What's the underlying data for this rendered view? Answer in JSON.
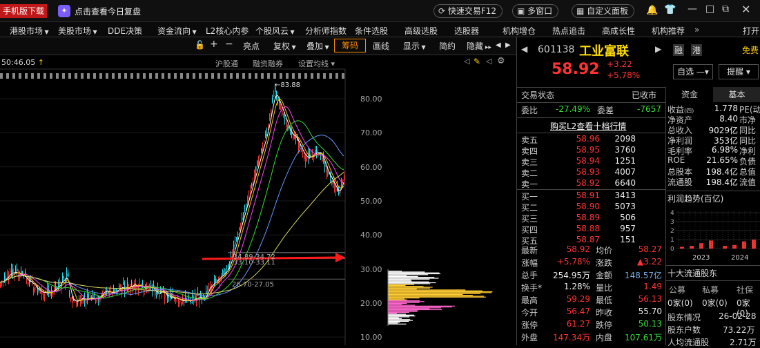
{
  "topbar": {
    "mobile_download": "手机版下载",
    "review_link": "点击查看今日复盘",
    "quick_trade": "快速交易F12",
    "multi_window": "多窗口",
    "custom_panel": "自定义面板"
  },
  "menu": [
    "港股市场",
    "美股市场",
    "DDE决策",
    "资金流向",
    "L2核心内参",
    "个股风云",
    "分析师指数",
    "条件选股",
    "高级选股",
    "选股器",
    "机构增仓",
    "热点追击",
    "高成长性",
    "机构推荐",
    "打开"
  ],
  "toolbar": {
    "items": [
      "亮点",
      "复权",
      "叠加",
      "筹码",
      "画线",
      "显示",
      "简约",
      "隐藏"
    ],
    "active": "筹码"
  },
  "chart": {
    "time_label": "50:46.05",
    "links": [
      "沪股通",
      "融资融券",
      "设置均线"
    ],
    "high_marker": "83.88",
    "yticks": [
      "80.00",
      "70.00",
      "60.00",
      "50.00",
      "40.00",
      "30.00",
      "20.00",
      "10.00"
    ],
    "chip_labels": [
      "34.89-34.72",
      "33.10-33.11",
      "26.70-27.05"
    ]
  },
  "quote": {
    "code": "601138",
    "name": "工业富联",
    "tag1": "融",
    "tag2": "港",
    "free_label": "免费",
    "price": "58.92",
    "change": "+3.22",
    "change_pct": "+5.78%",
    "watch_btn": "自选",
    "remind_btn": "提醒",
    "status_label": "交易状态",
    "status_value": "已收市",
    "webi_label": "委比",
    "webi_value": "-27.49%",
    "wecha_label": "委差",
    "wecha_value": "-7657",
    "l2_link": "购买L2查看十档行情"
  },
  "asks": [
    {
      "label": "卖五",
      "price": "58.96",
      "vol": "2098"
    },
    {
      "label": "卖四",
      "price": "58.95",
      "vol": "3760"
    },
    {
      "label": "卖三",
      "price": "58.94",
      "vol": "1251"
    },
    {
      "label": "卖二",
      "price": "58.93",
      "vol": "4007"
    },
    {
      "label": "卖一",
      "price": "58.92",
      "vol": "6640"
    }
  ],
  "bids": [
    {
      "label": "买一",
      "price": "58.91",
      "vol": "3413"
    },
    {
      "label": "买二",
      "price": "58.90",
      "vol": "5073"
    },
    {
      "label": "买三",
      "price": "58.89",
      "vol": "506"
    },
    {
      "label": "买四",
      "price": "58.88",
      "vol": "957"
    },
    {
      "label": "买五",
      "price": "58.87",
      "vol": "151"
    }
  ],
  "stats": [
    {
      "l1": "最新",
      "v1": "58.92",
      "c1": "red",
      "l2": "均价",
      "v2": "58.27",
      "c2": "red"
    },
    {
      "l1": "涨幅",
      "v1": "+5.78%",
      "c1": "red",
      "l2": "涨跌",
      "v2": "▲3.22",
      "c2": "red"
    },
    {
      "l1": "总手",
      "v1": "254.95万",
      "c1": "white",
      "l2": "金额",
      "v2": "148.57亿",
      "c2": "cy"
    },
    {
      "l1": "换手*",
      "v1": "1.28%",
      "c1": "white",
      "l2": "量比",
      "v2": "1.49",
      "c2": "red"
    },
    {
      "l1": "最高",
      "v1": "59.29",
      "c1": "red",
      "l2": "最低",
      "v2": "56.13",
      "c2": "red"
    },
    {
      "l1": "今开",
      "v1": "56.47",
      "c1": "red",
      "l2": "昨收",
      "v2": "55.70",
      "c2": "white"
    },
    {
      "l1": "涨停",
      "v1": "61.27",
      "c1": "red",
      "l2": "跌停",
      "v2": "50.13",
      "c2": "green"
    },
    {
      "l1": "外盘",
      "v1": "147.34万",
      "c1": "red",
      "l2": "内盘",
      "v2": "107.61万",
      "c2": "green"
    }
  ],
  "fund": {
    "tab_funds": "资金",
    "tab_basic": "基本",
    "rows": [
      {
        "label": "收益",
        "sup": "(四)",
        "value": "1.778",
        "extra": "PE(动"
      },
      {
        "label": "净资产",
        "sup": "",
        "value": "8.40",
        "extra": "市净"
      },
      {
        "label": "总收入",
        "sup": "",
        "value": "9029亿",
        "extra": "同比"
      },
      {
        "label": "净利润",
        "sup": "",
        "value": "353亿",
        "extra": "同比"
      },
      {
        "label": "毛利率",
        "sup": "",
        "value": "6.98%",
        "extra": "净利"
      },
      {
        "label": "ROE",
        "sup": "",
        "value": "21.65%",
        "extra": "负债"
      },
      {
        "label": "总股本",
        "sup": "",
        "value": "198.4亿",
        "extra": "总值"
      },
      {
        "label": "流通股",
        "sup": "",
        "value": "198.4亿",
        "extra": "流值"
      }
    ],
    "profit_title": "利润趋势(百亿)",
    "profit_yticks": [
      "4",
      "3",
      "2",
      "1",
      "0"
    ],
    "profit_years": [
      "2023",
      "2024"
    ],
    "holders_title": "十大流通股东",
    "holder_types": [
      "公募",
      "私募",
      "社保"
    ],
    "holder_counts": [
      "0家(0)",
      "0家(0)",
      "0家(0)"
    ],
    "holder_rows": [
      {
        "label": "股东情况",
        "value": "26-02-28"
      },
      {
        "label": "股东户数",
        "value": "73.22万"
      },
      {
        "label": "人均流通股",
        "value": "2.71万"
      }
    ]
  }
}
